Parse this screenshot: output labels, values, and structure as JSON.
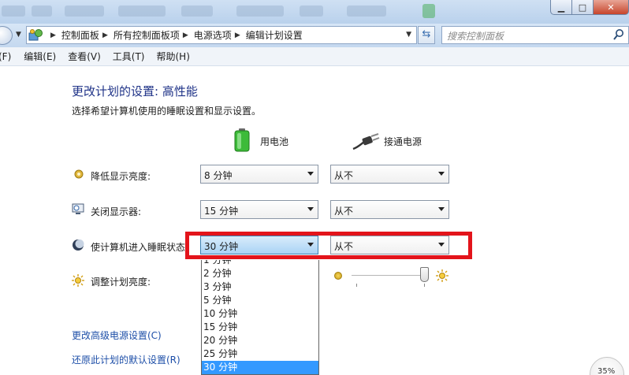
{
  "window": {
    "minimize_glyph": "▁",
    "maximize_glyph": "□",
    "close_glyph": "✕"
  },
  "address_bar": {
    "breadcrumbs": [
      "控制面板",
      "所有控制面板项",
      "电源选项",
      "编辑计划设置"
    ],
    "search_placeholder": "搜索控制面板"
  },
  "menu": {
    "items": [
      "(F)",
      "编辑(E)",
      "查看(V)",
      "工具(T)",
      "帮助(H)"
    ]
  },
  "page": {
    "title": "更改计划的设置: 高性能",
    "subtitle": "选择希望计算机使用的睡眠设置和显示设置。",
    "columns": {
      "battery": "用电池",
      "plugged_in": "接通电源"
    },
    "rows": [
      {
        "label": "降低显示亮度:",
        "battery": "8 分钟",
        "plugged_in": "从不",
        "icon": "dim-display-icon"
      },
      {
        "label": "关闭显示器:",
        "battery": "15 分钟",
        "plugged_in": "从不",
        "icon": "monitor-off-icon"
      },
      {
        "label": "使计算机进入睡眠状态:",
        "battery": "30 分钟",
        "plugged_in": "从不",
        "icon": "sleep-moon-icon"
      },
      {
        "label": "调整计划亮度:",
        "icon": "brightness-sun-icon"
      }
    ],
    "brightness_level_fraction": 0.95,
    "links": {
      "advanced": "更改高级电源设置(C)",
      "restore": "还原此计划的默认设置(R)"
    }
  },
  "dropdown": {
    "options": [
      "1 分钟",
      "2 分钟",
      "3 分钟",
      "5 分钟",
      "10 分钟",
      "15 分钟",
      "20 分钟",
      "25 分钟",
      "30 分钟"
    ],
    "selected": "30 分钟"
  },
  "tray": {
    "battery_percent": "35%"
  },
  "colors": {
    "highlight_border": "#e3141b",
    "selected_option": "#3399ff",
    "title_text": "#1e3287",
    "link_text": "#1e4fa8"
  }
}
